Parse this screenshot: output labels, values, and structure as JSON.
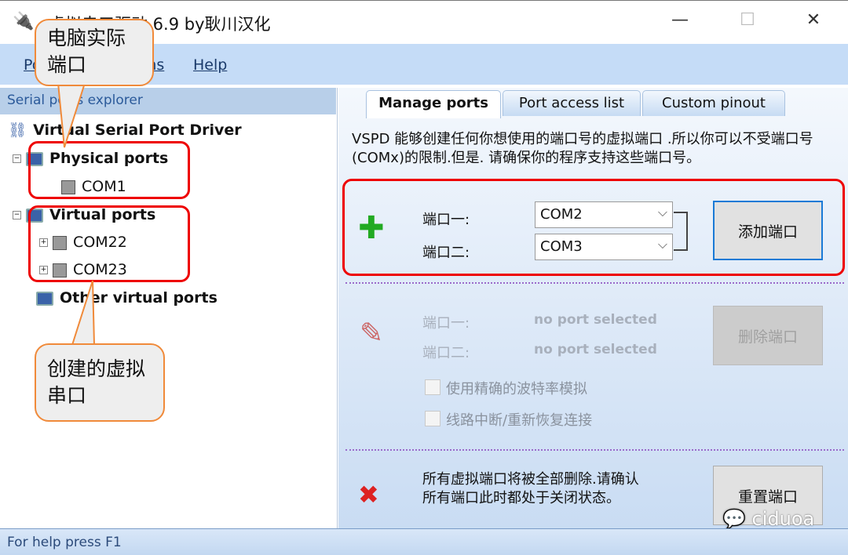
{
  "window": {
    "title": "虚拟串口驱动 6.9 by耿川汉化",
    "minimize": "—",
    "maximize": "☐",
    "close": "✕"
  },
  "menu": [
    "Port",
    "Options",
    "Help"
  ],
  "explorer": {
    "header": "Serial ports explorer",
    "root": "Virtual Serial Port Driver",
    "physical": "Physical ports",
    "physical_items": [
      "COM1"
    ],
    "virtual": "Virtual ports",
    "virtual_items": [
      "COM22",
      "COM23"
    ],
    "other": "Other virtual ports"
  },
  "tabs": [
    "Manage ports",
    "Port access list",
    "Custom pinout"
  ],
  "manage": {
    "description": "VSPD 能够创建任何你想使用的端口号的虚拟端口 .所以你可以不受端口号(COMx)的限制.但是. 请确保你的程序支持这些端口号。",
    "add": {
      "port1_label": "端口一:",
      "port2_label": "端口二:",
      "port1_value": "COM2",
      "port2_value": "COM3",
      "button": "添加端口"
    },
    "delete": {
      "port1_label": "端口一:",
      "port2_label": "端口二:",
      "port1_value": "no port selected",
      "port2_value": "no port selected",
      "button": "删除端口",
      "opt1": "使用精确的波特率模拟",
      "opt2": "线路中断/重新恢复连接"
    },
    "reset": {
      "text": "所有虚拟端口将被全部删除.请确认所有端口此时都处于关闭状态。",
      "button": "重置端口"
    }
  },
  "status": "For help press F1",
  "callouts": {
    "physical": "电脑实际端口",
    "virtual": "创建的虚拟串口"
  },
  "watermark": "ciduoa",
  "colors": {
    "highlight": "#e00000",
    "callout_border": "#f08a3a",
    "menubar": "#c5dcf7"
  }
}
